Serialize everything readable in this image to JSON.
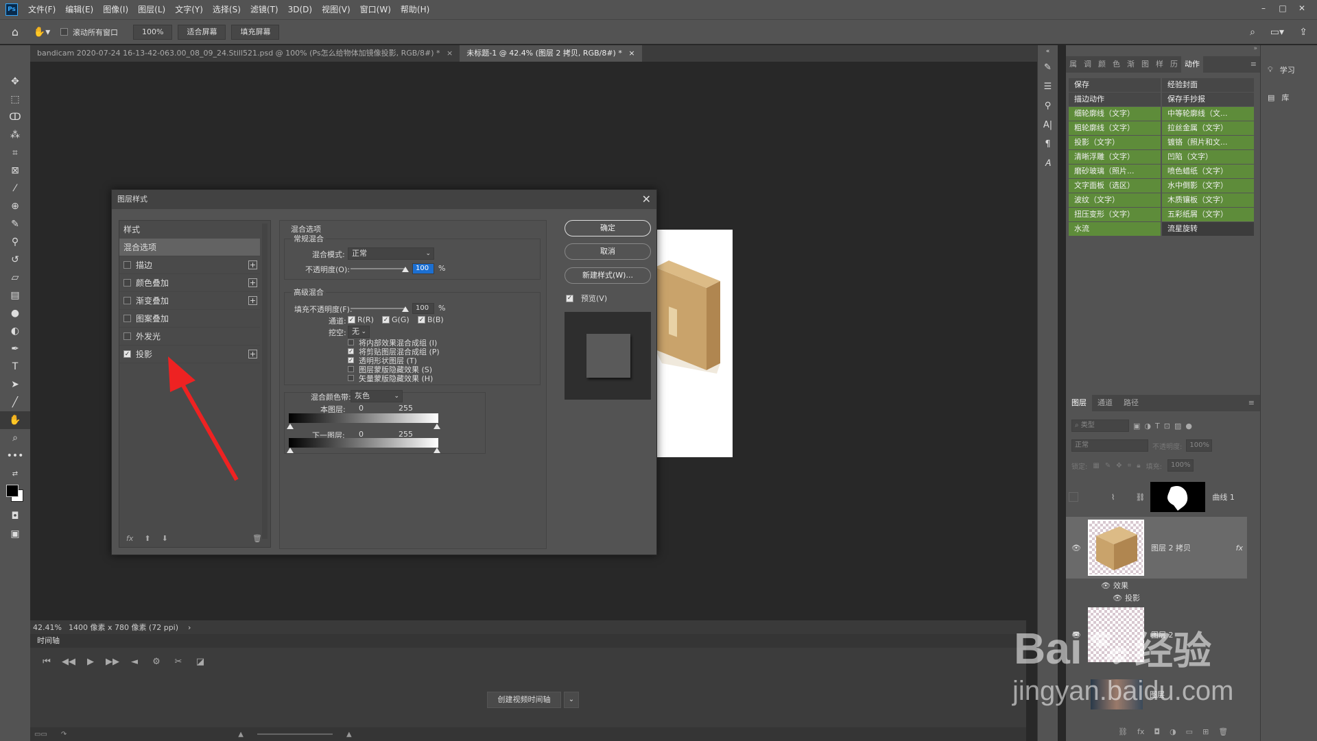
{
  "menu": [
    "文件(F)",
    "编辑(E)",
    "图像(I)",
    "图层(L)",
    "文字(Y)",
    "选择(S)",
    "滤镜(T)",
    "3D(D)",
    "视图(V)",
    "窗口(W)",
    "帮助(H)"
  ],
  "options": {
    "scroll_all": "滚动所有窗口",
    "zoom": "100%",
    "fit_screen": "适合屏幕",
    "fill_screen": "填充屏幕"
  },
  "tabs": [
    {
      "label": "bandicam 2020-07-24 16-13-42-063.00_08_09_24.Still521.psd @ 100% (Ps怎么给物体加镜像投影, RGB/8#) *",
      "close": "×"
    },
    {
      "label": "未标题-1 @ 42.4% (图层 2 拷贝, RGB/8#) *",
      "close": "×"
    }
  ],
  "status": {
    "zoom": "42.41%",
    "size": "1400 像素 x 780 像素 (72 ppi)",
    "arrow": "›"
  },
  "timeline": {
    "title": "时间轴",
    "create_button": "创建视频时间轴"
  },
  "dialog": {
    "title": "图层样式",
    "styles_header": "样式",
    "styles": [
      {
        "label": "混合选项",
        "checkbox": false,
        "plus": false,
        "checked": false,
        "selected": true
      },
      {
        "label": "描边",
        "checkbox": true,
        "plus": true,
        "checked": false
      },
      {
        "label": "颜色叠加",
        "checkbox": true,
        "plus": true,
        "checked": false
      },
      {
        "label": "渐变叠加",
        "checkbox": true,
        "plus": true,
        "checked": false
      },
      {
        "label": "图案叠加",
        "checkbox": true,
        "plus": false,
        "checked": false
      },
      {
        "label": "外发光",
        "checkbox": true,
        "plus": false,
        "checked": false
      },
      {
        "label": "投影",
        "checkbox": true,
        "plus": true,
        "checked": true
      }
    ],
    "footer": {
      "fx": "fx"
    },
    "blend": {
      "section": "混合选项",
      "general": "常规混合",
      "mode_label": "混合模式:",
      "mode_value": "正常",
      "opacity_label": "不透明度(O):",
      "opacity_value": "100",
      "opacity_pct": "%",
      "opacity_level": 1.0,
      "advanced": "高级混合",
      "fill_label": "填充不透明度(F):",
      "fill_value": "100",
      "fill_pct": "%",
      "fill_level": 1.0,
      "channels_label": "通道:",
      "ch_r": "R(R)",
      "ch_g": "G(G)",
      "ch_b": "B(B)",
      "knockout_label": "挖空:",
      "knockout_value": "无",
      "options": [
        {
          "label": "将内部效果混合成组 (I)",
          "checked": false
        },
        {
          "label": "将剪贴图层混合成组 (P)",
          "checked": true
        },
        {
          "label": "透明形状图层 (T)",
          "checked": true
        },
        {
          "label": "图层蒙版隐藏效果 (S)",
          "checked": false
        },
        {
          "label": "矢量蒙版隐藏效果 (H)",
          "checked": false
        }
      ],
      "band_label": "混合颜色带:",
      "band_value": "灰色",
      "this_layer": "本图层:",
      "under_layer": "下一图层:",
      "min": "0",
      "max": "255"
    },
    "buttons": {
      "ok": "确定",
      "cancel": "取消",
      "new_style": "新建样式(W)...",
      "preview": "预览(V)"
    }
  },
  "actions_tabs": [
    "属",
    "调",
    "颜",
    "色",
    "渐",
    "图",
    "样",
    "历",
    "动作"
  ],
  "actions": [
    {
      "label": "保存",
      "style": "gray"
    },
    {
      "label": "经验封面",
      "style": "gray"
    },
    {
      "label": "描边动作",
      "style": "gray"
    },
    {
      "label": "保存手抄报",
      "style": "gray"
    },
    {
      "label": "细轮廓线（文字）",
      "style": "green"
    },
    {
      "label": "中等轮廓线（文...",
      "style": "green"
    },
    {
      "label": "粗轮廓线（文字）",
      "style": "green"
    },
    {
      "label": "拉丝金属（文字）",
      "style": "green"
    },
    {
      "label": "投影（文字）",
      "style": "green"
    },
    {
      "label": "镀铬（照片和文...",
      "style": "green"
    },
    {
      "label": "清晰浮雕（文字）",
      "style": "green"
    },
    {
      "label": "凹陷（文字）",
      "style": "green"
    },
    {
      "label": "磨砂玻璃（照片...",
      "style": "green"
    },
    {
      "label": "喷色蜡纸（文字）",
      "style": "green"
    },
    {
      "label": "文字面板（选区）",
      "style": "green"
    },
    {
      "label": "水中倒影（文字）",
      "style": "green"
    },
    {
      "label": "波纹（文字）",
      "style": "green"
    },
    {
      "label": "木质镶板（文字）",
      "style": "green"
    },
    {
      "label": "扭压变形（文字）",
      "style": "green"
    },
    {
      "label": "五彩纸屑（文字）",
      "style": "green"
    },
    {
      "label": "水流",
      "style": "green"
    },
    {
      "label": "流星旋转",
      "style": "dark"
    }
  ],
  "far_right": {
    "learn": "学习",
    "library": "库"
  },
  "layers": {
    "tabs": [
      "图层",
      "通道",
      "路径"
    ],
    "search": "类型",
    "blend_mode": "正常",
    "opacity_label": "不透明度:",
    "opacity_value": "100%",
    "lock_label": "锁定:",
    "fill_label": "填充:",
    "fill_value": "100%",
    "items": [
      {
        "name": "曲线 1"
      },
      {
        "name": "图层 2 拷贝",
        "fx": "fx"
      },
      {
        "name": "效果"
      },
      {
        "name": "投影"
      },
      {
        "name": "图层 2"
      },
      {
        "name": "图层"
      }
    ]
  },
  "watermark": {
    "brand": "Bai",
    "brand2": "经验",
    "url": "jingyan.baidu.com"
  }
}
